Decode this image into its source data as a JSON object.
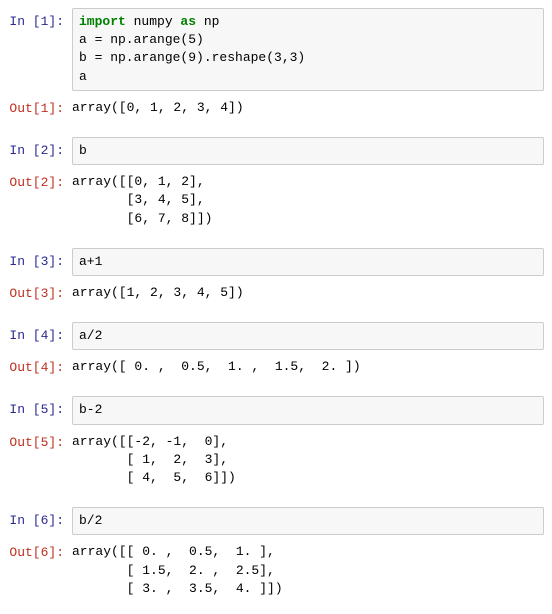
{
  "cells": [
    {
      "in_prompt": "In [1]:",
      "code_lines": [
        {
          "prefix": "",
          "import_kw": "import",
          "mid": " numpy ",
          "as_kw": "as",
          "suffix": " np"
        },
        "a = np.arange(5)",
        "b = np.arange(9).reshape(3,3)",
        "a"
      ],
      "out_prompt": "Out[1]:",
      "out_text": "array([0, 1, 2, 3, 4])"
    },
    {
      "in_prompt": "In [2]:",
      "code_lines": [
        "b"
      ],
      "out_prompt": "Out[2]:",
      "out_text": "array([[0, 1, 2],\n       [3, 4, 5],\n       [6, 7, 8]])"
    },
    {
      "in_prompt": "In [3]:",
      "code_lines": [
        "a+1"
      ],
      "out_prompt": "Out[3]:",
      "out_text": "array([1, 2, 3, 4, 5])"
    },
    {
      "in_prompt": "In [4]:",
      "code_lines": [
        "a/2"
      ],
      "out_prompt": "Out[4]:",
      "out_text": "array([ 0. ,  0.5,  1. ,  1.5,  2. ])"
    },
    {
      "in_prompt": "In [5]:",
      "code_lines": [
        "b-2"
      ],
      "out_prompt": "Out[5]:",
      "out_text": "array([[-2, -1,  0],\n       [ 1,  2,  3],\n       [ 4,  5,  6]])"
    },
    {
      "in_prompt": "In [6]:",
      "code_lines": [
        "b/2"
      ],
      "out_prompt": "Out[6]:",
      "out_text": "array([[ 0. ,  0.5,  1. ],\n       [ 1.5,  2. ,  2.5],\n       [ 3. ,  3.5,  4. ]])"
    }
  ]
}
